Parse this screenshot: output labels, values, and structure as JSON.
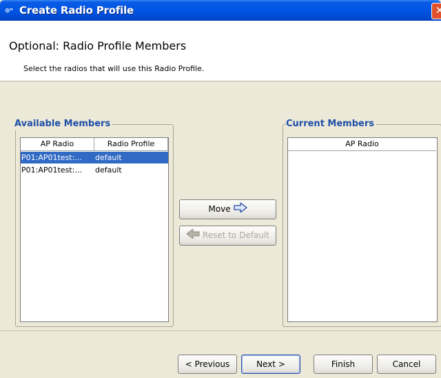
{
  "window": {
    "title": "Create Radio Profile",
    "close_glyph": "✕"
  },
  "header": {
    "title": "Optional: Radio Profile Members",
    "subtitle": "Select the radios that will use this Radio Profile."
  },
  "available": {
    "legend": "Available Members",
    "columns": [
      "AP Radio",
      "Radio Profile"
    ],
    "rows": [
      {
        "ap_radio": "P01:AP01test:...",
        "profile": "default",
        "selected": true
      },
      {
        "ap_radio": "P01:AP01test:...",
        "profile": "default",
        "selected": false
      }
    ]
  },
  "current": {
    "legend": "Current Members",
    "columns": [
      "AP Radio"
    ]
  },
  "actions": {
    "move_label": "Move",
    "reset_label": "Reset to Default"
  },
  "footer": {
    "previous_label": "< Previous",
    "next_label": "Next >",
    "finish_label": "Finish",
    "cancel_label": "Cancel"
  },
  "icons": {
    "app": "app-logo-icon",
    "move": "arrow-right-icon",
    "reset": "arrow-left-icon"
  }
}
